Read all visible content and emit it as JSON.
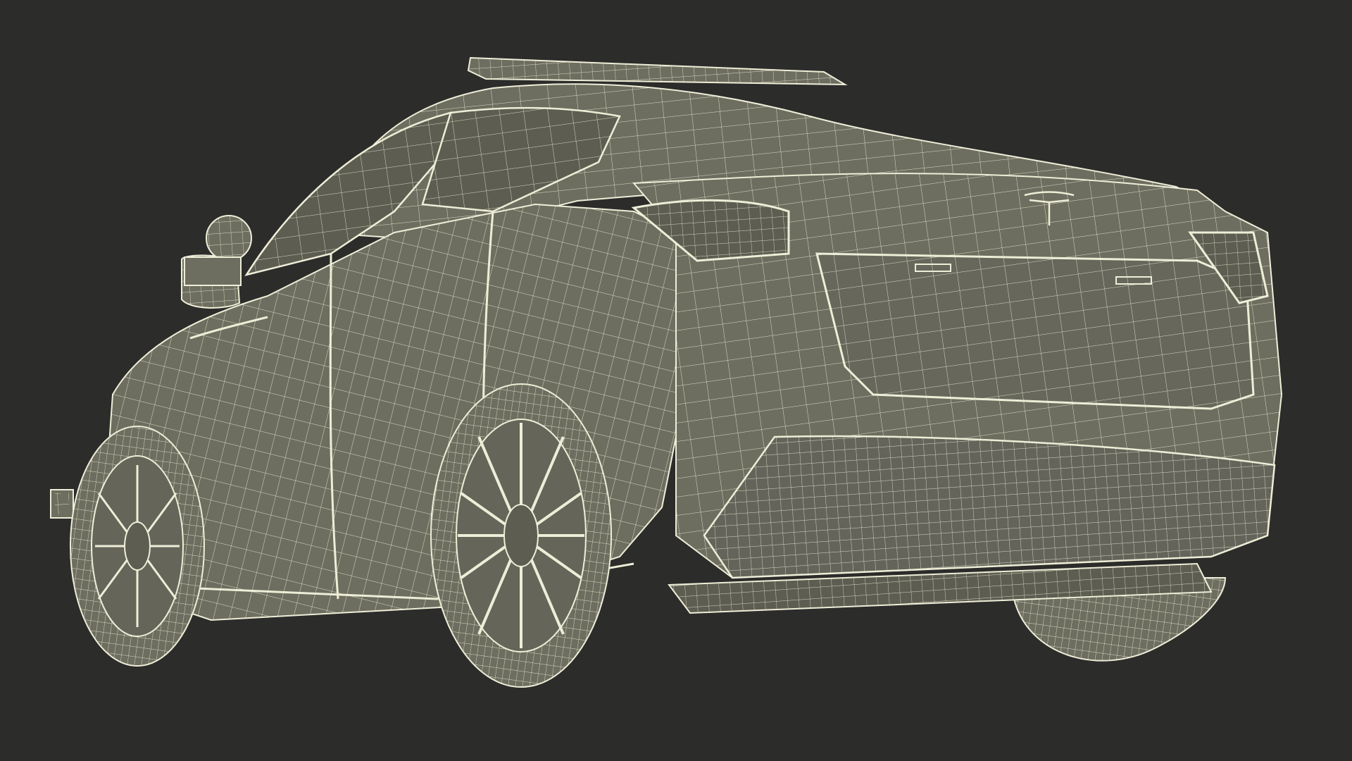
{
  "scene": {
    "subject": "3d-car-wireframe",
    "view": "rear-three-quarter",
    "background_color": "#2c2c2b",
    "body_fill": "#6e6e60",
    "body_fill_dark": "#5d5d51",
    "wire_color": "#eeeed8",
    "badge": "tesla-logo"
  }
}
